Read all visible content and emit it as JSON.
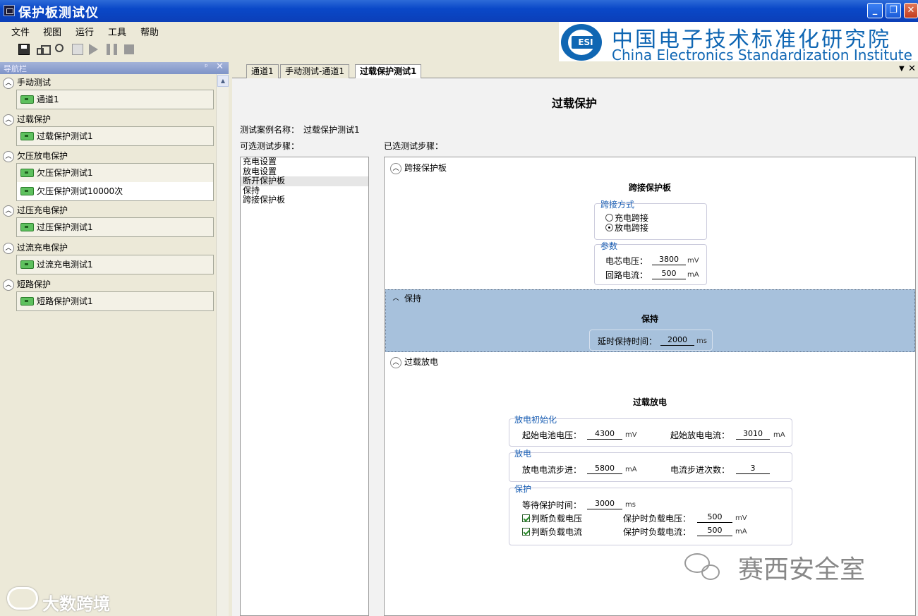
{
  "window": {
    "title": "保护板测试仪"
  },
  "menu": [
    "文件",
    "视图",
    "运行",
    "工具",
    "帮助"
  ],
  "logo": {
    "mark": "ESI",
    "cn": "中国电子技术标准化研究院",
    "en": "China Electronics Standardization Institute"
  },
  "nav": {
    "title": "导航栏",
    "groups": [
      {
        "label": "手动测试",
        "items": [
          "通道1"
        ]
      },
      {
        "label": "过载保护",
        "items": [
          "过载保护测试1"
        ]
      },
      {
        "label": "欠压放电保护",
        "items": [
          "欠压保护测试1",
          "欠压保护测试10000次"
        ]
      },
      {
        "label": "过压充电保护",
        "items": [
          "过压保护测试1"
        ]
      },
      {
        "label": "过流充电保护",
        "items": [
          "过流充电测试1"
        ]
      },
      {
        "label": "短路保护",
        "items": [
          "短路保护测试1"
        ]
      }
    ]
  },
  "tabs": [
    "通道1",
    "手动测试-通道1",
    "过载保护测试1"
  ],
  "main": {
    "page_title": "过载保护",
    "case_name_label": "测试案例名称：",
    "case_name": "过载保护测试1",
    "available_label": "可选测试步骤：",
    "selected_label": "已选测试步骤：",
    "available_steps": [
      "充电设置",
      "放电设置",
      "断开保护板",
      "保持",
      "跨接保护板"
    ]
  },
  "steps": {
    "bypass": {
      "head": "跨接保护板",
      "title": "跨接保护板",
      "method_label": "跨接方式",
      "radio_charge": "充电跨接",
      "radio_discharge": "放电跨接",
      "params_label": "参数",
      "cell_v_label": "电芯电压：",
      "cell_v": "3800",
      "cell_v_unit": "mV",
      "loop_i_label": "回路电流：",
      "loop_i": "500",
      "loop_i_unit": "mA"
    },
    "hold": {
      "head": "保持",
      "title": "保持",
      "delay_label": "延时保持时间：",
      "delay": "2000",
      "delay_unit": "ms"
    },
    "overload": {
      "head": "过载放电",
      "title": "过载放电",
      "init_label": "放电初始化",
      "start_v_label": "起始电池电压：",
      "start_v": "4300",
      "start_v_unit": "mV",
      "start_i_label": "起始放电电流：",
      "start_i": "3010",
      "start_i_unit": "mA",
      "discharge_label": "放电",
      "step_i_label": "放电电流步进：",
      "step_i": "5800",
      "step_i_unit": "mA",
      "step_count_label": "电流步进次数：",
      "step_count": "3",
      "protect_label": "保护",
      "wait_label": "等待保护时间：",
      "wait": "3000",
      "wait_unit": "ms",
      "check_v": "判断负载电压",
      "check_i": "判断负载电流",
      "prot_v_label": "保护时负载电压：",
      "prot_v": "500",
      "prot_v_unit": "mV",
      "prot_i_label": "保护时负载电流：",
      "prot_i": "500",
      "prot_i_unit": "mA"
    }
  },
  "watermarks": {
    "right": "赛西安全室",
    "left": "大数跨境"
  }
}
